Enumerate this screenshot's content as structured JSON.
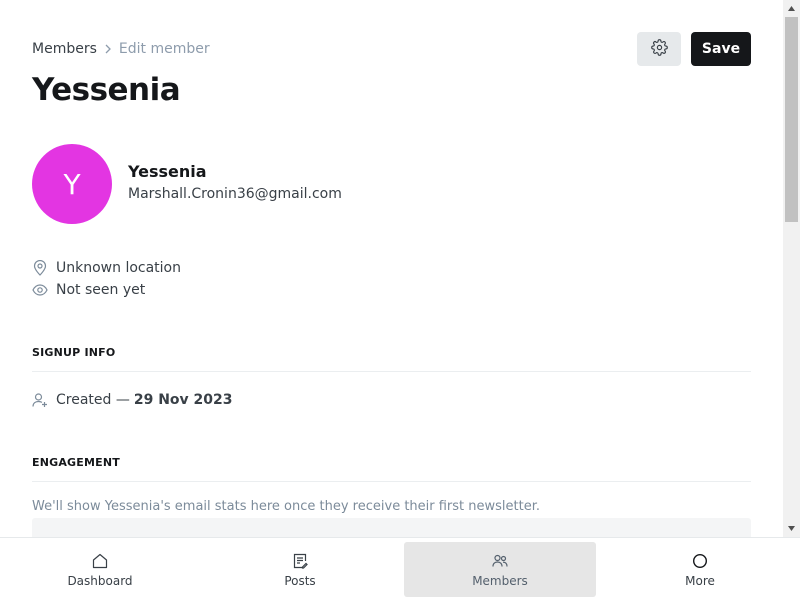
{
  "breadcrumb": {
    "parent": "Members",
    "current": "Edit member"
  },
  "header": {
    "title": "Yessenia",
    "save_label": "Save"
  },
  "member": {
    "avatar_initial": "Y",
    "avatar_color": "#e335e2",
    "name": "Yessenia",
    "email": "Marshall.Cronin36@gmail.com",
    "location": "Unknown location",
    "last_seen": "Not seen yet"
  },
  "signup": {
    "section_label": "SIGNUP INFO",
    "created_prefix": "Created —",
    "created_date": "29 Nov 2023"
  },
  "engagement": {
    "section_label": "ENGAGEMENT",
    "note": "We'll show Yessenia's email stats here once they receive their first newsletter."
  },
  "nav": {
    "items": [
      {
        "label": "Dashboard",
        "icon": "home-icon"
      },
      {
        "label": "Posts",
        "icon": "posts-icon"
      },
      {
        "label": "Members",
        "icon": "members-icon",
        "active": true
      },
      {
        "label": "More",
        "icon": "more-icon"
      }
    ]
  },
  "colors": {
    "primary": "#15171a",
    "muted": "#8e9cac",
    "active_nav_bg": "#e6e6e6"
  }
}
